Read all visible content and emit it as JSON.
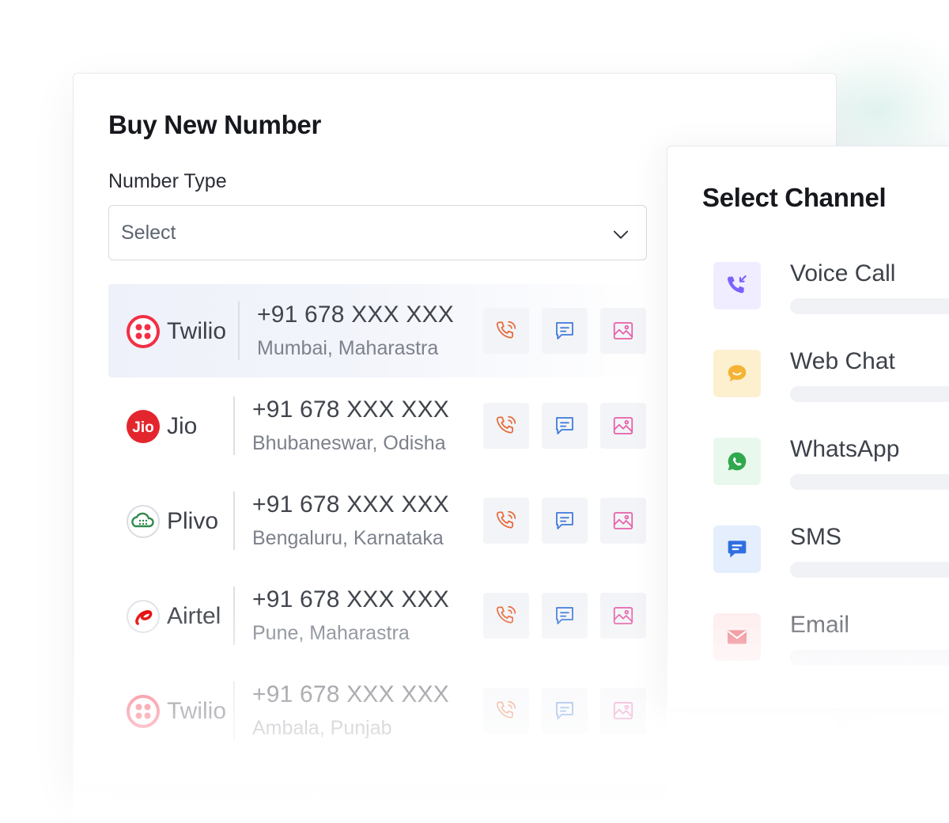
{
  "buy_number": {
    "title": "Buy New Number",
    "number_type_label": "Number Type",
    "select_value": "Select",
    "rows": [
      {
        "provider": "Twilio",
        "number": "+91 678 XXX XXX",
        "location": "Mumbai, Maharastra"
      },
      {
        "provider": "Jio",
        "number": "+91 678 XXX XXX",
        "location": "Bhubaneswar, Odisha"
      },
      {
        "provider": "Plivo",
        "number": "+91 678 XXX XXX",
        "location": "Bengaluru, Karnataka"
      },
      {
        "provider": "Airtel",
        "number": "+91 678 XXX XXX",
        "location": "Pune, Maharastra"
      },
      {
        "provider": "Twilio",
        "number": "+91 678 XXX XXX",
        "location": "Ambala, Punjab"
      }
    ],
    "actions": [
      "phone-call-icon",
      "chat-icon",
      "image-icon"
    ]
  },
  "select_channel": {
    "title": "Select Channel",
    "channels": [
      {
        "label": "Voice Call",
        "icon": "voice-call-icon",
        "color": "#7b61ff"
      },
      {
        "label": "Web Chat",
        "icon": "web-chat-icon",
        "color": "#f5b335"
      },
      {
        "label": "WhatsApp",
        "icon": "whatsapp-icon",
        "color": "#2fa84f"
      },
      {
        "label": "SMS",
        "icon": "sms-icon",
        "color": "#2f6fe0"
      },
      {
        "label": "Email",
        "icon": "email-icon",
        "color": "#e9606a"
      }
    ]
  },
  "colors": {
    "twilio": "#f22f46",
    "jio": "#e3262e",
    "plivo": "#2f8a4a",
    "airtel": "#e40000",
    "call_icon": "#e66a3a",
    "chat_icon": "#3d79d8",
    "image_icon": "#e65fa8"
  }
}
